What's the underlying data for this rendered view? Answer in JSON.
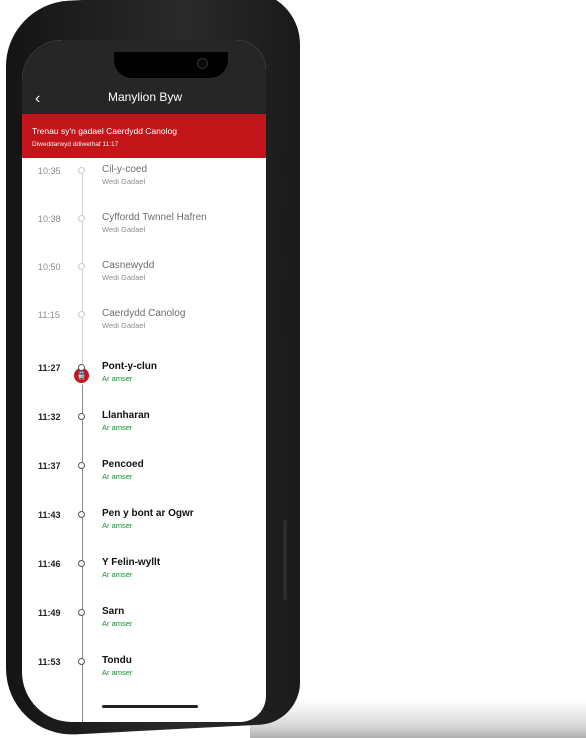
{
  "app": {
    "title": "Manylion Byw",
    "back_glyph": "‹"
  },
  "banner": {
    "title": "Trenau sy'n gadael Caerdydd Canolog",
    "updated": "Diweddarwyd ddiwethaf 11:17"
  },
  "icons": {
    "train_glyph": "🚆"
  },
  "colors": {
    "brand_red": "#c2161b",
    "on_time_green": "#1a8a3a",
    "appbar_dark": "#262626"
  },
  "stops": [
    {
      "time": "10:35",
      "name": "Cil-y-coed",
      "status": "Wedi Gadael",
      "state": "departed"
    },
    {
      "time": "10:38",
      "name": "Cyffordd Twnnel Hafren",
      "status": "Wedi Gadael",
      "state": "departed"
    },
    {
      "time": "10:50",
      "name": "Casnewydd",
      "status": "Wedi Gadael",
      "state": "departed"
    },
    {
      "time": "11:15",
      "name": "Caerdydd Canolog",
      "status": "Wedi Gadael",
      "state": "departed"
    },
    {
      "time": "11:27",
      "name": "Pont-y-clun",
      "status": "Ar amser",
      "state": "upcoming"
    },
    {
      "time": "11:32",
      "name": "Llanharan",
      "status": "Ar amser",
      "state": "upcoming"
    },
    {
      "time": "11:37",
      "name": "Pencoed",
      "status": "Ar amser",
      "state": "upcoming"
    },
    {
      "time": "11:43",
      "name": "Pen y bont ar Ogwr",
      "status": "Ar amser",
      "state": "upcoming"
    },
    {
      "time": "11:46",
      "name": "Y Felin-wyllt",
      "status": "Ar amser",
      "state": "upcoming"
    },
    {
      "time": "11:49",
      "name": "Sarn",
      "status": "Ar amser",
      "state": "upcoming"
    },
    {
      "time": "11:53",
      "name": "Tondu",
      "status": "Ar amser",
      "state": "upcoming"
    }
  ]
}
